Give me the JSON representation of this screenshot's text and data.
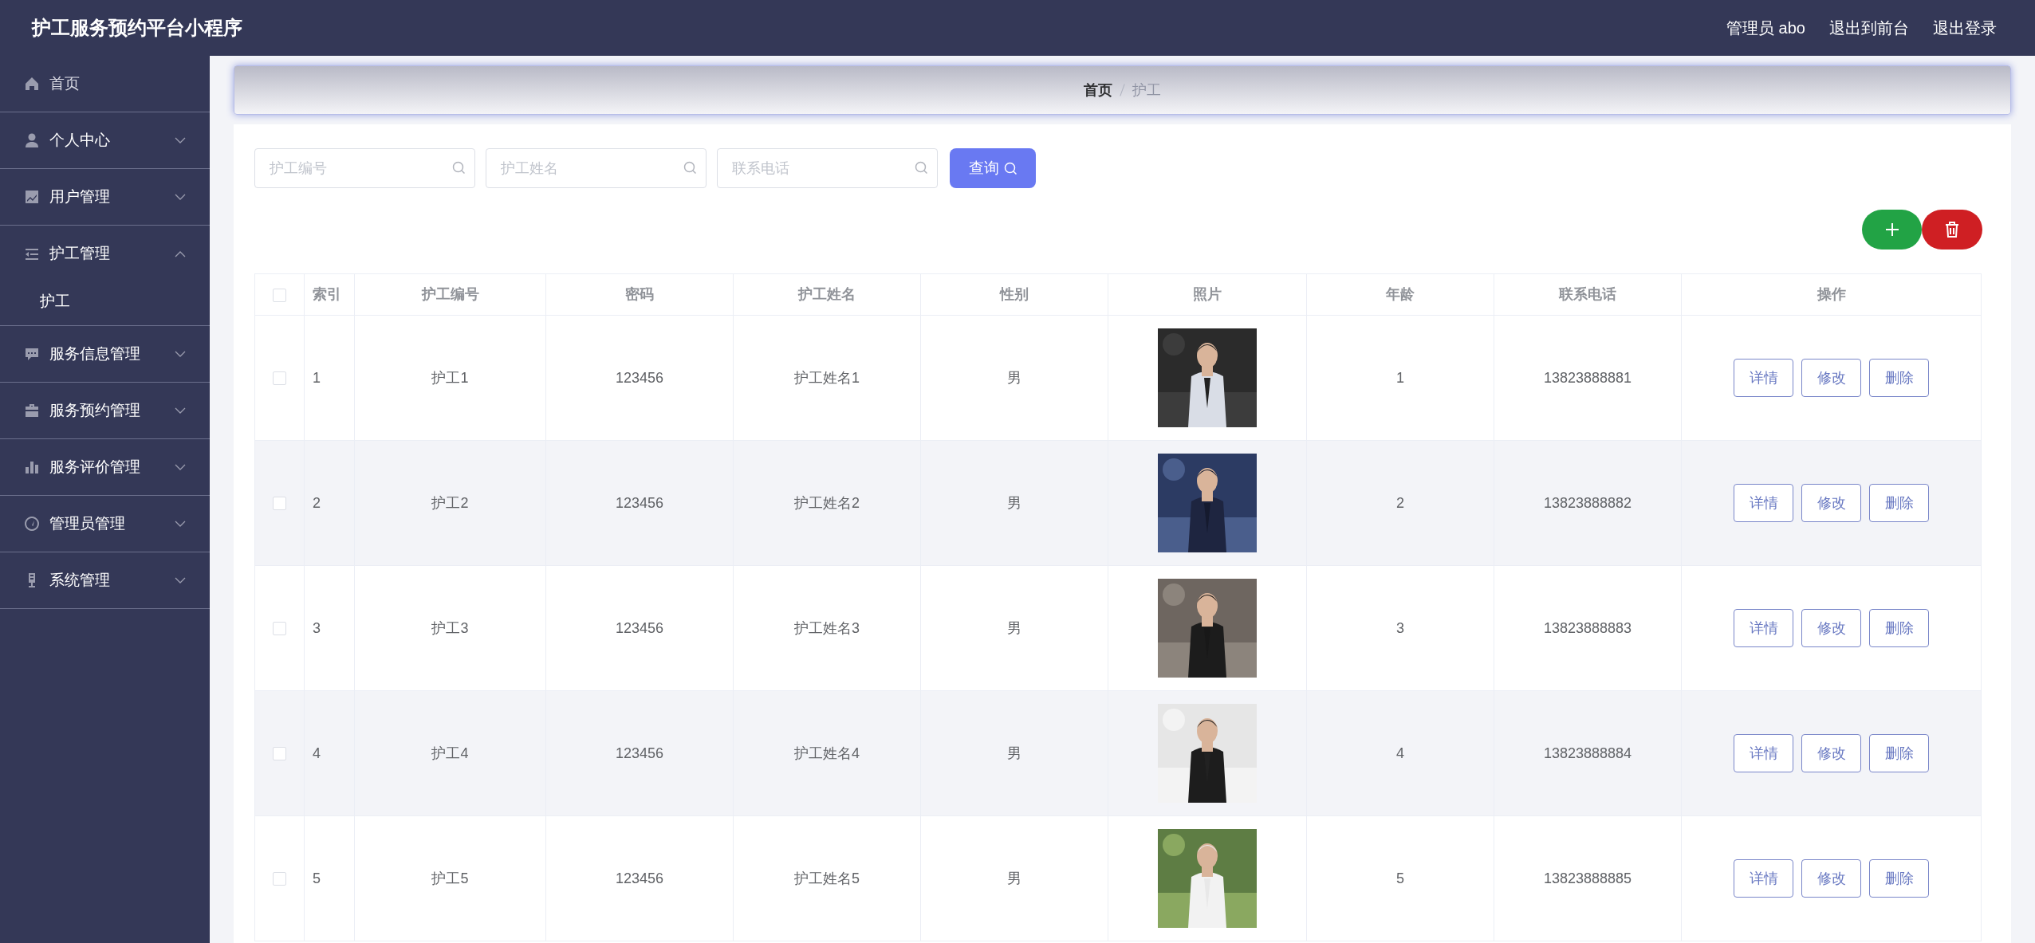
{
  "header": {
    "title": "护工服务预约平台小程序",
    "links": [
      "管理员 abo",
      "退出到前台",
      "退出登录"
    ]
  },
  "sidebar": {
    "items": [
      {
        "label": "首页",
        "kind": "link"
      },
      {
        "label": "个人中心",
        "kind": "menu",
        "expanded": false
      },
      {
        "label": "用户管理",
        "kind": "menu",
        "expanded": false
      },
      {
        "label": "护工管理",
        "kind": "menu",
        "expanded": true,
        "children": [
          {
            "label": "护工"
          }
        ]
      },
      {
        "label": "服务信息管理",
        "kind": "menu",
        "expanded": false
      },
      {
        "label": "服务预约管理",
        "kind": "menu",
        "expanded": false
      },
      {
        "label": "服务评价管理",
        "kind": "menu",
        "expanded": false
      },
      {
        "label": "管理员管理",
        "kind": "menu",
        "expanded": false
      },
      {
        "label": "系统管理",
        "kind": "menu",
        "expanded": false
      }
    ]
  },
  "breadcrumb": [
    "首页",
    "护工"
  ],
  "search": {
    "fields": [
      {
        "placeholder": "护工编号"
      },
      {
        "placeholder": "护工姓名"
      },
      {
        "placeholder": "联系电话"
      }
    ],
    "button": "查询"
  },
  "table": {
    "select_all_checked": false,
    "columns": [
      "索引",
      "护工编号",
      "密码",
      "护工姓名",
      "性别",
      "照片",
      "年龄",
      "联系电话",
      "操作"
    ],
    "rows": [
      {
        "checked": false,
        "cells": [
          "1",
          "护工1",
          "123456",
          "护工姓名1",
          "男",
          "",
          "1",
          "13823888881"
        ],
        "photo": {
          "kind": "picture"
        },
        "actions": [
          "详情",
          "修改",
          "删除"
        ]
      },
      {
        "checked": false,
        "cells": [
          "2",
          "护工2",
          "123456",
          "护工姓名2",
          "男",
          "",
          "2",
          "13823888882"
        ],
        "photo": {
          "kind": "picture"
        },
        "actions": [
          "详情",
          "修改",
          "删除"
        ]
      },
      {
        "checked": false,
        "cells": [
          "3",
          "护工3",
          "123456",
          "护工姓名3",
          "男",
          "",
          "3",
          "13823888883"
        ],
        "photo": {
          "kind": "picture"
        },
        "actions": [
          "详情",
          "修改",
          "删除"
        ]
      },
      {
        "checked": false,
        "cells": [
          "4",
          "护工4",
          "123456",
          "护工姓名4",
          "男",
          "",
          "4",
          "13823888884"
        ],
        "photo": {
          "kind": "picture"
        },
        "actions": [
          "详情",
          "修改",
          "删除"
        ]
      },
      {
        "checked": false,
        "cells": [
          "5",
          "护工5",
          "123456",
          "护工姓名5",
          "男",
          "",
          "5",
          "13823888885"
        ],
        "photo": {
          "kind": "picture"
        },
        "actions": [
          "详情",
          "修改",
          "删除"
        ]
      }
    ]
  }
}
